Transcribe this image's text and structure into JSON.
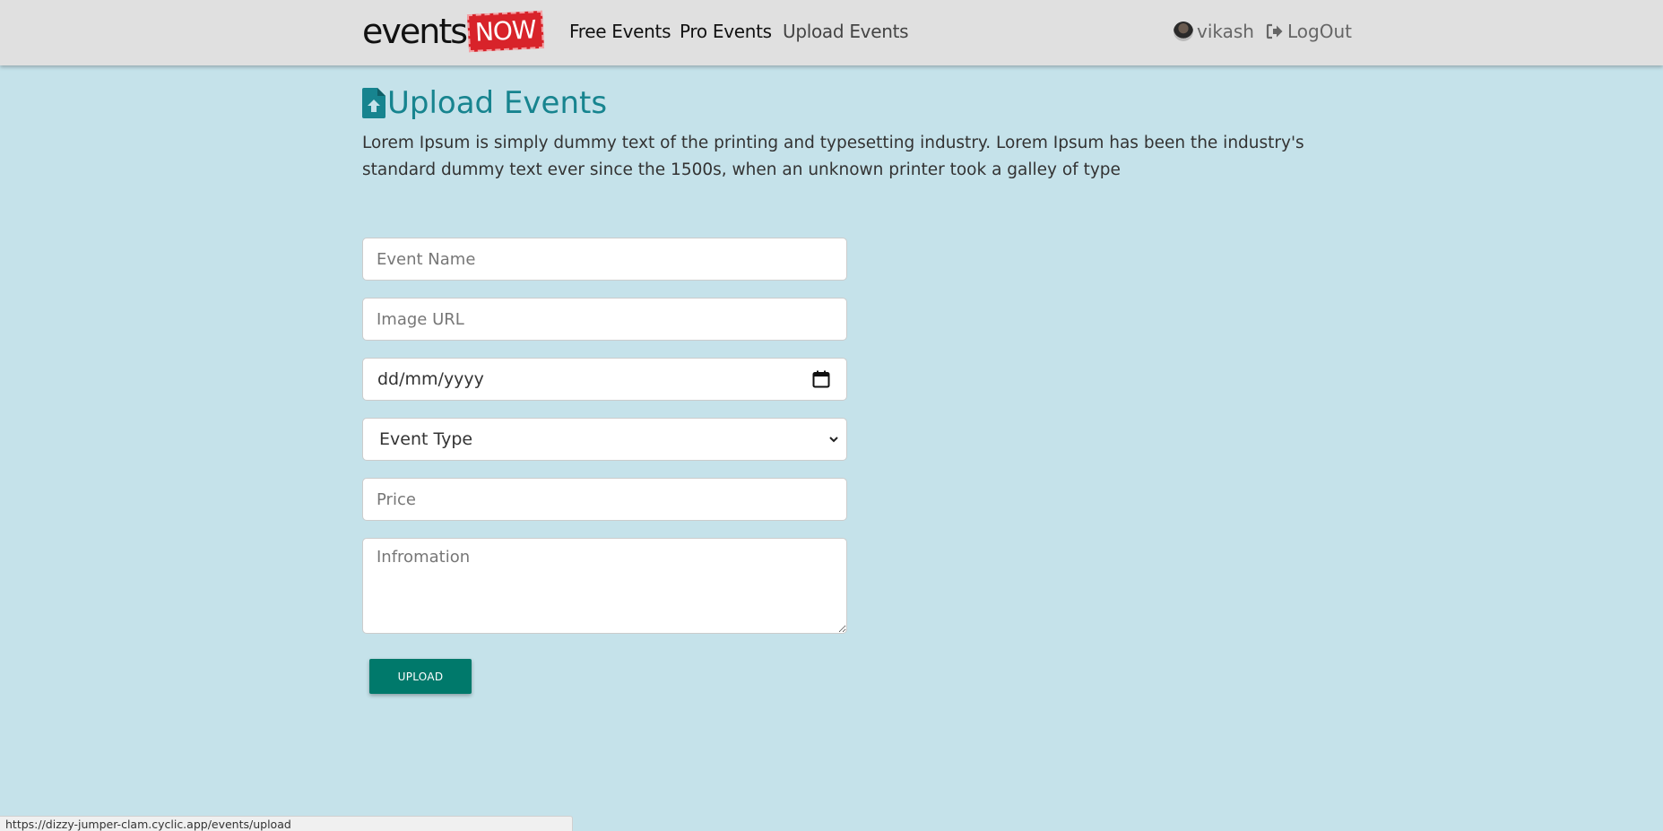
{
  "nav": {
    "brand_events": "events",
    "brand_now": "NOW",
    "links": [
      "Free Events",
      "Pro Events",
      "Upload Events"
    ],
    "user_name": "vikash",
    "logout_label": "LogOut"
  },
  "page": {
    "title": "Upload Events",
    "description": "Lorem Ipsum is simply dummy text of the printing and typesetting industry. Lorem Ipsum has been the industry's standard dummy text ever since the 1500s, when an unknown printer took a galley of type"
  },
  "form": {
    "event_name_placeholder": "Event Name",
    "image_url_placeholder": "Image URL",
    "date_placeholder": "dd/mm/yyyy",
    "event_type_selected": "Event Type",
    "price_placeholder": "Price",
    "information_placeholder": "Infromation",
    "submit_label": "UPLOAD"
  },
  "status_bar": {
    "url": "https://dizzy-jumper-clam.cyclic.app/events/upload"
  },
  "colors": {
    "background": "#c5e2ea",
    "navbar": "#e0e0e0",
    "title_accent": "#17848f",
    "button": "#00796b",
    "brand_red": "#d8232a"
  }
}
